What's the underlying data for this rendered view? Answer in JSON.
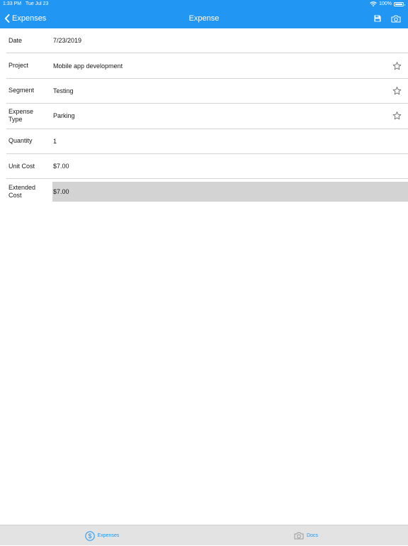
{
  "status_bar": {
    "time": "1:33 PM",
    "date": "Tue Jul 23",
    "battery": "100%"
  },
  "nav": {
    "back_label": "Expenses",
    "title": "Expense",
    "save_icon": "save-icon",
    "camera_icon": "camera-icon"
  },
  "form": {
    "date": {
      "label": "Date",
      "value": "7/23/2019"
    },
    "project": {
      "label": "Project",
      "value": "Mobile app development"
    },
    "segment": {
      "label": "Segment",
      "value": "Testing"
    },
    "expense_type": {
      "label": "Expense\nType",
      "value": "Parking"
    },
    "quantity": {
      "label": "Quantity",
      "value": "1"
    },
    "unit_cost": {
      "label": "Unit Cost",
      "value": "$7.00"
    },
    "extended_cost": {
      "label": "Extended\nCost",
      "value": "$7.00"
    }
  },
  "tabs": {
    "expenses": {
      "label": "Expenses",
      "icon": "dollar-circle-icon"
    },
    "docs": {
      "label": "Docs",
      "icon": "camera-icon"
    }
  },
  "colors": {
    "accent": "#2196f3",
    "tab_bar": "#e3e3e3",
    "highlight": "#d3d3d3"
  }
}
